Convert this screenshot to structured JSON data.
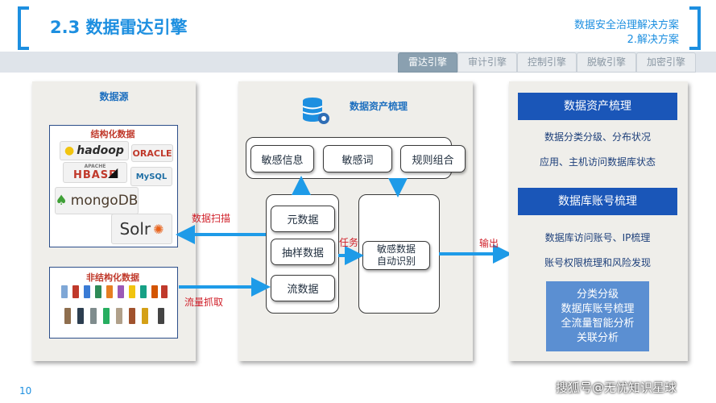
{
  "header": {
    "title": "2.3 数据雷达引擎",
    "subtitle_1": "数据安全治理解决方案",
    "subtitle_2": "2.解决方案"
  },
  "tabs": [
    "雷达引擎",
    "审计引擎",
    "控制引擎",
    "脱敏引擎",
    "加密引擎"
  ],
  "left": {
    "title": "数据源",
    "structured_title": "结构化数据",
    "unstructured_title": "非结构化数据",
    "logos": [
      "hadoop",
      "ORACLE",
      "HBASE",
      "MySQL",
      "mongoDB",
      "Solr"
    ],
    "apache": "APACHE"
  },
  "middle": {
    "title": "数据资产梳理",
    "top_boxes": [
      "敏感信息",
      "敏感词",
      "规则组合"
    ],
    "left_boxes": [
      "元数据",
      "抽样数据",
      "流数据"
    ],
    "right_box_line1": "敏感数据",
    "right_box_line2": "自动识别"
  },
  "labels": {
    "scan": "数据扫描",
    "capture": "流量抓取",
    "task": "任务",
    "output": "输出"
  },
  "right": {
    "head_1": "数据资产梳理",
    "item_1a": "数据分类分级、分布状况",
    "item_1b": "应用、主机访问数据库状态",
    "head_2": "数据库账号梳理",
    "item_2a": "数据库访问账号、IP梳理",
    "item_2b": "账号权限梳理和风险发现",
    "summary": [
      "分类分级",
      "数据库账号梳理",
      "全流量智能分析",
      "关联分析"
    ]
  },
  "footer": {
    "page": "10",
    "watermark": "搜狐号@无忧知识星球"
  },
  "colors": {
    "accent": "#1d8fe0",
    "head_blue": "#1a56b8",
    "arrow": "#1e9be8",
    "summary_bg": "#5b8fd2"
  }
}
